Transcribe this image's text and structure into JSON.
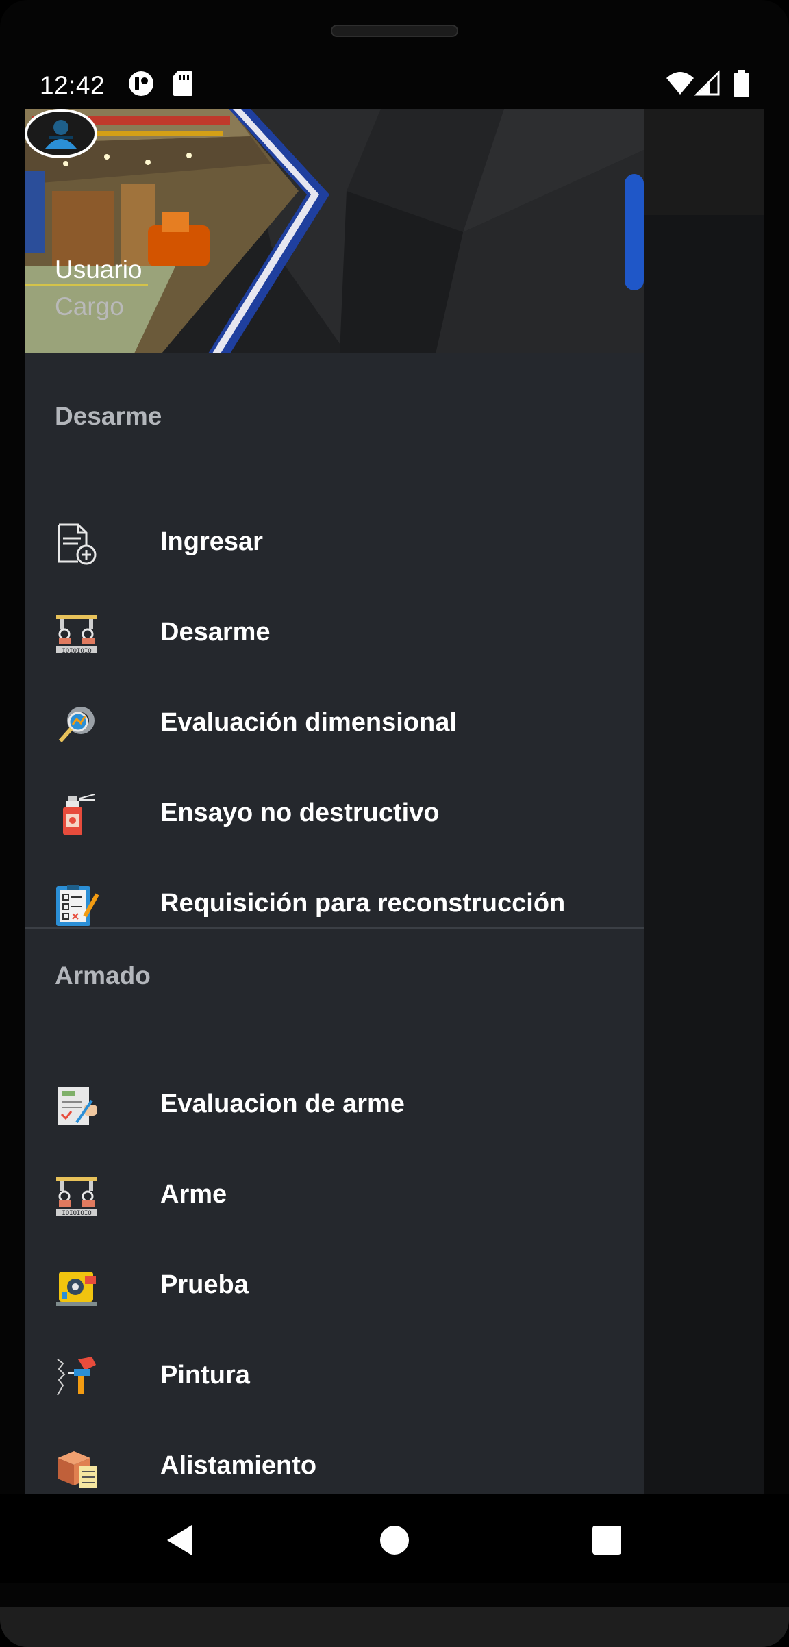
{
  "status_bar": {
    "time": "12:42"
  },
  "drawer": {
    "header": {
      "user_name": "Usuario",
      "user_role": "Cargo"
    },
    "sections": [
      {
        "title": "Desarme",
        "items": [
          {
            "label": "Ingresar",
            "icon": "file-add-icon"
          },
          {
            "label": "Desarme",
            "icon": "machine-disassembly-icon"
          },
          {
            "label": "Evaluación dimensional",
            "icon": "gear-magnifier-icon"
          },
          {
            "label": "Ensayo no destructivo",
            "icon": "spray-can-icon"
          },
          {
            "label": "Requisición para reconstrucción",
            "icon": "clipboard-checklist-icon"
          }
        ]
      },
      {
        "title": "Armado",
        "items": [
          {
            "label": "Evaluacion de arme",
            "icon": "document-pencil-icon"
          },
          {
            "label": "Arme",
            "icon": "machine-assembly-icon"
          },
          {
            "label": "Prueba",
            "icon": "test-machine-icon"
          },
          {
            "label": "Pintura",
            "icon": "paint-gun-icon"
          },
          {
            "label": "Alistamiento",
            "icon": "box-checklist-icon"
          }
        ]
      }
    ]
  },
  "colors": {
    "drawer_bg": "#25282d",
    "accent": "#2b8fd6",
    "scrim": "#141517"
  }
}
